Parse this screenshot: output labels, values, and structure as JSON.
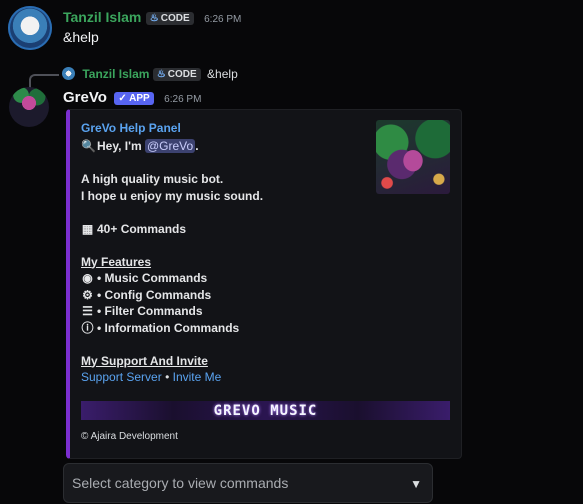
{
  "msg1": {
    "author": "Tanzil Islam",
    "tag": "CODE",
    "time": "6:26 PM",
    "text": "&help"
  },
  "reply": {
    "author": "Tanzil Islam",
    "tag": "CODE",
    "text": "&help"
  },
  "msg2": {
    "author": "GreVo",
    "badge": "✓ APP",
    "time": "6:26 PM"
  },
  "embed": {
    "title": "GreVo Help Panel",
    "hey": "Hey, I'm",
    "mention": "@GreVo",
    "hey_end": ".",
    "line1": "A high quality music bot.",
    "line2": "I hope u enjoy my music sound.",
    "commands_count": "40+ Commands",
    "features_heading": "My Features",
    "features": [
      "• Music Commands",
      "• Config Commands",
      "• Filter Commands",
      "• Information Commands"
    ],
    "support_heading": "My Support And Invite",
    "support_link": "Support Server",
    "link_sep": "•",
    "invite_link": "Invite Me",
    "banner_text": "GREVO MUSIC",
    "footer": "© Ajaira Development",
    "accent_color": "#7b2fd0"
  },
  "select": {
    "placeholder": "Select category to view commands"
  },
  "colors": {
    "background": "#070709",
    "author_green": "#3ba55d",
    "link_blue": "#5aa3f0",
    "app_badge": "#5865f2"
  }
}
